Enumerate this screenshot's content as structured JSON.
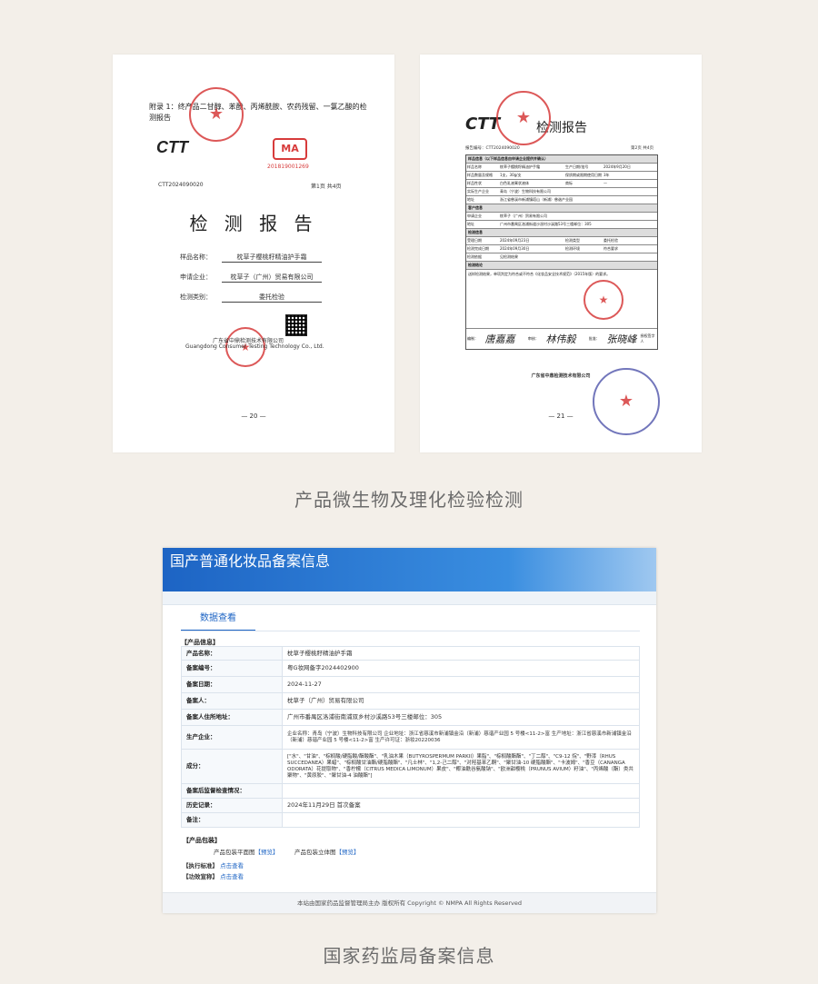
{
  "left_doc": {
    "appendix": "附录 1：终产品二甘醇、苯酚、丙烯酰胺、农药残留、一氯乙酸的检测报告",
    "ctt_logo": "CTT",
    "cma_logo": "MA",
    "cma_no": "201819001269",
    "report_no": "CTT2024090020",
    "page_label": "第1页  共4页",
    "title": "检 测 报 告",
    "sample_label": "样品名称：",
    "sample_value": "枕草子樱桃籽精油护手霜",
    "applicant_label": "申请企业：",
    "applicant_value": "枕草子（广州）贸易有限公司",
    "type_label": "检测类别：",
    "type_value": "委托检验",
    "company_cn": "广东省中鼎检测技术有限公司",
    "company_en": "Guangdong Consumer Testing Technology Co., Ltd.",
    "page_num": "— 20 —"
  },
  "right_doc": {
    "ctt_logo": "CTT",
    "title": "检测报告",
    "report_no": "报告编号：CTT2024090020",
    "page_label": "第2页  共4页",
    "section1": "样品信息（以下样品信息由申请企业提供并确认）",
    "rows": [
      [
        "样品名称",
        "枕草子樱桃籽精油护手霜",
        "生产日期/批号",
        "2024年9月20日"
      ],
      [
        "样品数量及规格",
        "1支，30g/支",
        "保质期或限期使用日期",
        "3年"
      ],
      [
        "样品性状",
        "白色乳液膏状液体",
        "商标",
        "—"
      ],
      [
        "实际生产企业",
        "青岛（宁波）生物科技有限公司",
        "",
        ""
      ],
      [
        "地址",
        "浙江省慈溪市新浦镇塔山（新浦）慈谐产业园",
        "",
        ""
      ]
    ],
    "section2": "客户信息",
    "client_rows": [
      [
        "申请企业",
        "枕草子（广州）贸易有限公司"
      ],
      [
        "地址",
        "广州市番禺区洛浦街道沙滘村沙溪路53号三楼邮位：305"
      ]
    ],
    "section3": "检测信息",
    "test_rows": [
      [
        "受理日期",
        "2024年09月23日",
        "检测类型",
        "委托检验"
      ],
      [
        "检测完成日期",
        "2024年09月30日",
        "检测环境",
        "符合要求"
      ],
      [
        "检测依据",
        "见检测结果",
        "",
        ""
      ]
    ],
    "section4": "检测结论",
    "conclusion": "送样检测结果，单项判定为符合或不符合《化妆品安全技术规范》（2015年版）的要求。",
    "signers": [
      "编制：",
      "审核：",
      "批准："
    ],
    "sig_names": [
      "唐嘉嘉",
      "林伟毅",
      "张晓峰"
    ],
    "signer_title": "授权签字人",
    "company": "广东省中鼎检测技术有限公司",
    "page_num": "— 21 —"
  },
  "caption1": "产品微生物及理化检验检测",
  "reg": {
    "header": "国产普通化妆品备案信息",
    "tab": "数据查看",
    "section_product": "【产品信息】",
    "fields": [
      {
        "k": "产品名称：",
        "v": "枕草子樱桃籽精油护手霜"
      },
      {
        "k": "备案编号：",
        "v": "粤G妆网备字2024402900"
      },
      {
        "k": "备案日期：",
        "v": "2024-11-27"
      },
      {
        "k": "备案人：",
        "v": "枕草子（广州）贸易有限公司"
      },
      {
        "k": "备案人住所地址：",
        "v": "广州市番禺区洛浦街南浦双乡村沙溪路53号三楼邮位：305"
      },
      {
        "k": "生产企业：",
        "v": "企业名称：青岛（宁波）生物科技有限公司 企业地址：浙江省慈溪市新浦镇金沿（新浦）慈谐产业园 5 号楼<11-2>富 生产地址：浙江省慈溪市新浦镇金沿（新浦）慈谐产业园 5 号楼<11-2>富 生产许可证：浙妆20220036"
      },
      {
        "k": "成分：",
        "v": "[\"水\"、\"甘油\"、\"棕榈酸/硬脂酸/酯酸酯\"、\"乳油木果（BUTYROSPERMUM PARKII）果脂\"、\"棕榈酸酯酯\"、\"丁二醇\"、\"C9-12 烷\"、\"野漆（RHUS SUCCEDANEA）果蜡\"、\"棕榈酸甘油酯/硬脂酸酯\"、\"凡士林\"、\"1,2-己二醇\"、\"对羟基苯乙酮\"、\"聚甘油-10 硬脂酸酯\"、\"卡波姆\"、\"香豆（CANANGA ODORATA）花提取物\"、\"香柠檬（CITRUS MEDICA LIMONUM）果皮\"、\"椰油酰谷氨酸钠\"、\"欧洲甜樱桃（PRUNUS AVIUM）籽油\"、\"丙烯酸（酯）类共聚物\"、\"黄原胶\"、\"聚甘油-4 油酸酯\"]"
      },
      {
        "k": "备案后监督检查情况：",
        "v": ""
      },
      {
        "k": "历史记录：",
        "v": "2024年11月29日 首次备案"
      },
      {
        "k": "备注：",
        "v": ""
      }
    ],
    "section_pack": "【产品包装】",
    "pack_flat": "产品包装平面图",
    "pack_flat_link": "【预览】",
    "pack_3d": "产品包装立体图",
    "pack_3d_link": "【预览】",
    "std_label": "【执行标准】",
    "std_link": "点击查看",
    "claim_label": "【功效宣称】",
    "claim_link": "点击查看",
    "footer": "本站由国家药品监督管理局主办 版权所有 Copyright © NMPA All Rights Reserved"
  },
  "caption2": "国家药监局备案信息"
}
